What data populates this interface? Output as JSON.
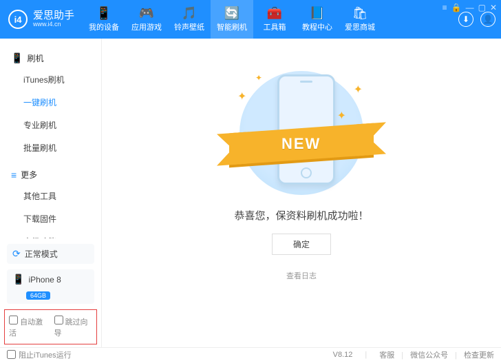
{
  "brand": {
    "logo_text": "i4",
    "name_cn": "爱思助手",
    "url": "www.i4.cn"
  },
  "nav": [
    {
      "icon": "📱",
      "label": "我的设备"
    },
    {
      "icon": "🎮",
      "label": "应用游戏"
    },
    {
      "icon": "🎵",
      "label": "铃声壁纸"
    },
    {
      "icon": "🔄",
      "label": "智能刷机",
      "active": true
    },
    {
      "icon": "🧰",
      "label": "工具箱"
    },
    {
      "icon": "📘",
      "label": "教程中心"
    },
    {
      "icon": "🛍",
      "label": "爱思商城"
    }
  ],
  "sidebar": {
    "sections": [
      {
        "icon": "📱",
        "title": "刷机",
        "items": [
          "iTunes刷机",
          "一键刷机",
          "专业刷机",
          "批量刷机"
        ],
        "active_index": 1
      },
      {
        "icon": "≡",
        "title": "更多",
        "items": [
          "其他工具",
          "下载固件",
          "高级功能"
        ],
        "active_index": -1
      }
    ],
    "mode_chip": {
      "label": "正常模式"
    },
    "device_chip": {
      "name": "iPhone 8",
      "storage": "64GB"
    },
    "bottom_checks": [
      {
        "label": "自动激活",
        "checked": false
      },
      {
        "label": "跳过向导",
        "checked": false
      }
    ]
  },
  "content": {
    "ribbon_text": "NEW",
    "success_text": "恭喜您，保资料刷机成功啦！",
    "ok_button": "确定",
    "log_link": "查看日志"
  },
  "footer": {
    "left_checkbox": {
      "label": "阻止iTunes运行",
      "checked": false
    },
    "version": "V8.12",
    "right_links": [
      "客服",
      "微信公众号",
      "检查更新"
    ]
  }
}
